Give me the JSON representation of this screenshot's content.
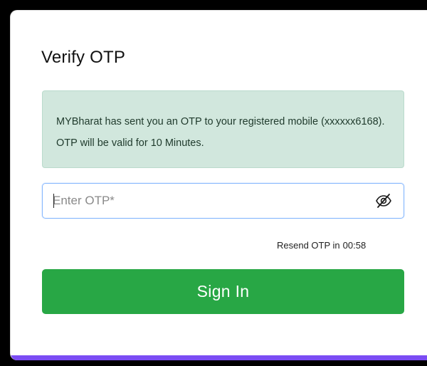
{
  "title": "Verify OTP",
  "alert": {
    "message": "MYBharat has sent you an OTP to your registered mobile (xxxxxx6168). OTP will be valid for 10 Minutes."
  },
  "otp_input": {
    "placeholder": "Enter OTP*",
    "value": "",
    "toggle_icon": "eye-slash-icon"
  },
  "resend": {
    "label": "Resend OTP in",
    "timer": "00:58"
  },
  "signin_button": {
    "label": "Sign In"
  },
  "colors": {
    "alert_background": "#d1e7dd",
    "button": "#28a745",
    "input_focus_border": "#86b7fe",
    "bottom_accent": "#7b4cf3"
  }
}
